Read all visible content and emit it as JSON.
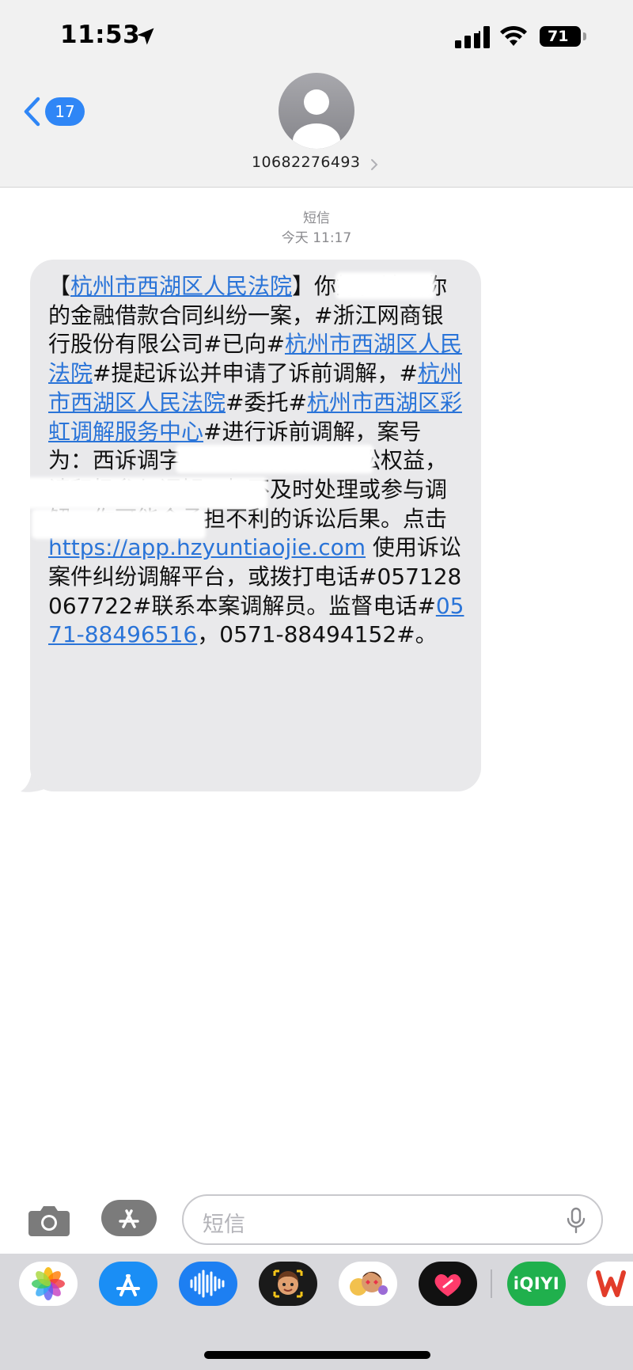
{
  "status_bar": {
    "time": "11:53",
    "battery": "71",
    "icons": [
      "location-arrow-icon",
      "cellular-signal-icon",
      "wifi-icon",
      "battery-icon"
    ]
  },
  "header": {
    "back_badge": "17",
    "contact_number": "10682276493",
    "icons": [
      "chevron-left-icon",
      "avatar-icon",
      "chevron-right-icon"
    ]
  },
  "conversation": {
    "kind": "短信",
    "timestamp": "今天 11:17"
  },
  "message": {
    "t0": "【",
    "l1": "杭州市西湖区人民法院",
    "t1": "】",
    "t1b": "你好，涉及你的金融借款合同纠纷一案，#浙江网商银行股份有限公司#已向#",
    "l2": "杭州市西湖区人民法院",
    "t2": "#提起诉讼并申请了诉前调解，#",
    "l3": "杭州市西湖区人民法院",
    "t3": "#委托#",
    "l4": "杭州市西湖区彩虹调解服务中心",
    "t4": "#进行诉前调解，案号为：",
    "t4b": "西诉调字第",
    "t4c": "为了保障你的诉讼权益，请积极参与调解。如不及时处理或参与调解，你可能会承担不利的诉讼后果。点击 ",
    "l5": "https://app.hzyuntiaojie.com",
    "t5": " 使用诉讼案件纠纷调解平台，或拨打电话#057128067722#联系本案调解员。监督电话#",
    "l6": "0571-88496516",
    "t6": "，0571-88494152#。"
  },
  "input_bar": {
    "placeholder": "短信",
    "icons": [
      "camera-icon",
      "app-store-icon",
      "microphone-icon"
    ]
  },
  "app_drawer": {
    "iqiyi_label": "iQIYI",
    "icons": [
      "photos-icon",
      "app-store-icon",
      "audio-message-icon",
      "memoji-icon",
      "stickers-icon",
      "digital-touch-heart-icon",
      "iqiyi-icon",
      "wps-icon"
    ]
  },
  "colors": {
    "link": "#2a74d8",
    "accent_blue": "#2f86f6",
    "bubble": "#e9e9eb",
    "header_bg": "#f1f1f1"
  }
}
